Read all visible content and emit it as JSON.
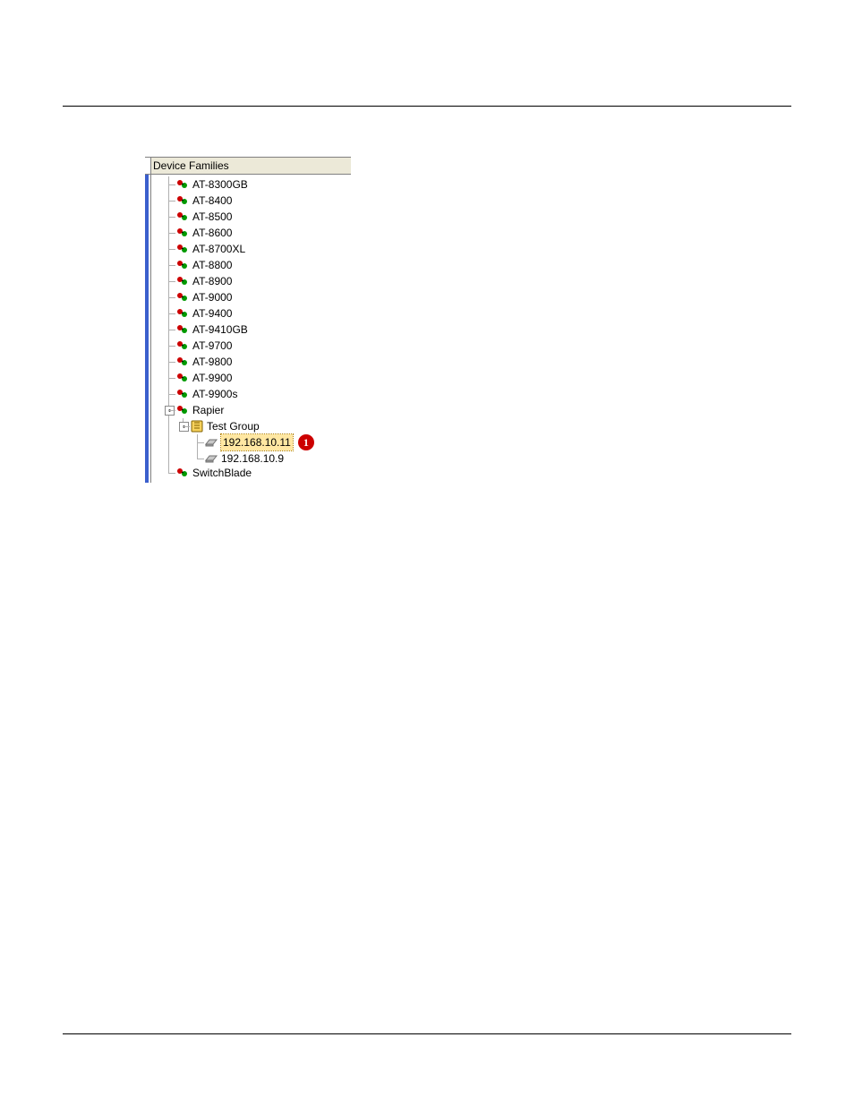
{
  "panel": {
    "title": "Device Families"
  },
  "tree": {
    "families": [
      {
        "label": "AT-8300GB"
      },
      {
        "label": "AT-8400"
      },
      {
        "label": "AT-8500"
      },
      {
        "label": "AT-8600"
      },
      {
        "label": "AT-8700XL"
      },
      {
        "label": "AT-8800"
      },
      {
        "label": "AT-8900"
      },
      {
        "label": "AT-9000"
      },
      {
        "label": "AT-9400"
      },
      {
        "label": "AT-9410GB"
      },
      {
        "label": "AT-9700"
      },
      {
        "label": "AT-9800"
      },
      {
        "label": "AT-9900"
      },
      {
        "label": "AT-9900s"
      }
    ],
    "expanded": {
      "label": "Rapier",
      "group": {
        "label": "Test Group",
        "devices": [
          {
            "label": "192.168.10.11",
            "selected": true
          },
          {
            "label": "192.168.10.9",
            "selected": false
          }
        ]
      }
    },
    "lastCut": {
      "label": "SwitchBlade"
    }
  },
  "callouts": {
    "selectedDevice": "1"
  }
}
